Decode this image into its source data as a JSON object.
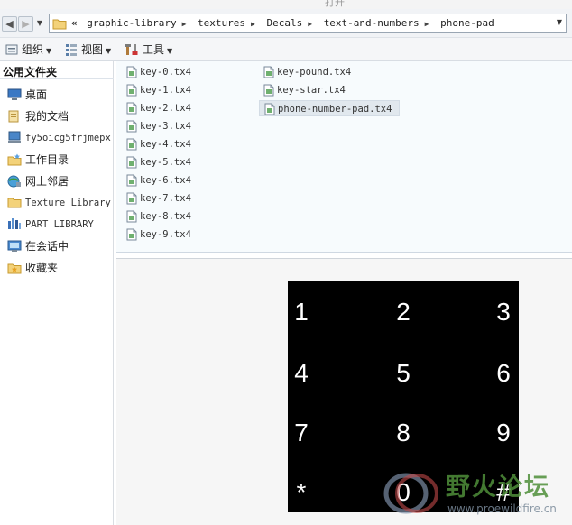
{
  "window": {
    "title": "打开"
  },
  "address": {
    "lead": "«",
    "crumbs": [
      "graphic-library",
      "textures",
      "Decals",
      "text-and-numbers",
      "phone-pad"
    ]
  },
  "toolbar": {
    "organize": "组织",
    "view": "视图",
    "tools": "工具"
  },
  "sidebar": {
    "header": "公用文件夹",
    "items": [
      {
        "label": "桌面",
        "icon": "desktop-icon"
      },
      {
        "label": "我的文档",
        "icon": "documents-icon"
      },
      {
        "label": "fy5oicg5frjmepx",
        "icon": "computer-icon"
      },
      {
        "label": "工作目录",
        "icon": "working-dir-icon"
      },
      {
        "label": "网上邻居",
        "icon": "network-icon"
      },
      {
        "label": "Texture Library",
        "icon": "folder-icon"
      },
      {
        "label": "PART LIBRARY",
        "icon": "library-icon"
      },
      {
        "label": "在会话中",
        "icon": "session-icon"
      },
      {
        "label": "收藏夹",
        "icon": "favorites-icon"
      }
    ]
  },
  "files": {
    "column1": [
      "key-0.tx4",
      "key-1.tx4",
      "key-2.tx4",
      "key-3.tx4",
      "key-4.tx4",
      "key-5.tx4",
      "key-6.tx4",
      "key-7.tx4",
      "key-8.tx4",
      "key-9.tx4"
    ],
    "column2": [
      "key-pound.tx4",
      "key-star.tx4",
      "phone-number-pad.tx4"
    ],
    "selected": "phone-number-pad.tx4"
  },
  "preview": {
    "keys": [
      "1",
      "2",
      "3",
      "4",
      "5",
      "6",
      "7",
      "8",
      "9",
      "*",
      "0",
      "#"
    ]
  },
  "watermark": {
    "text": "野火论坛",
    "url": "www.proewildfire.cn"
  }
}
